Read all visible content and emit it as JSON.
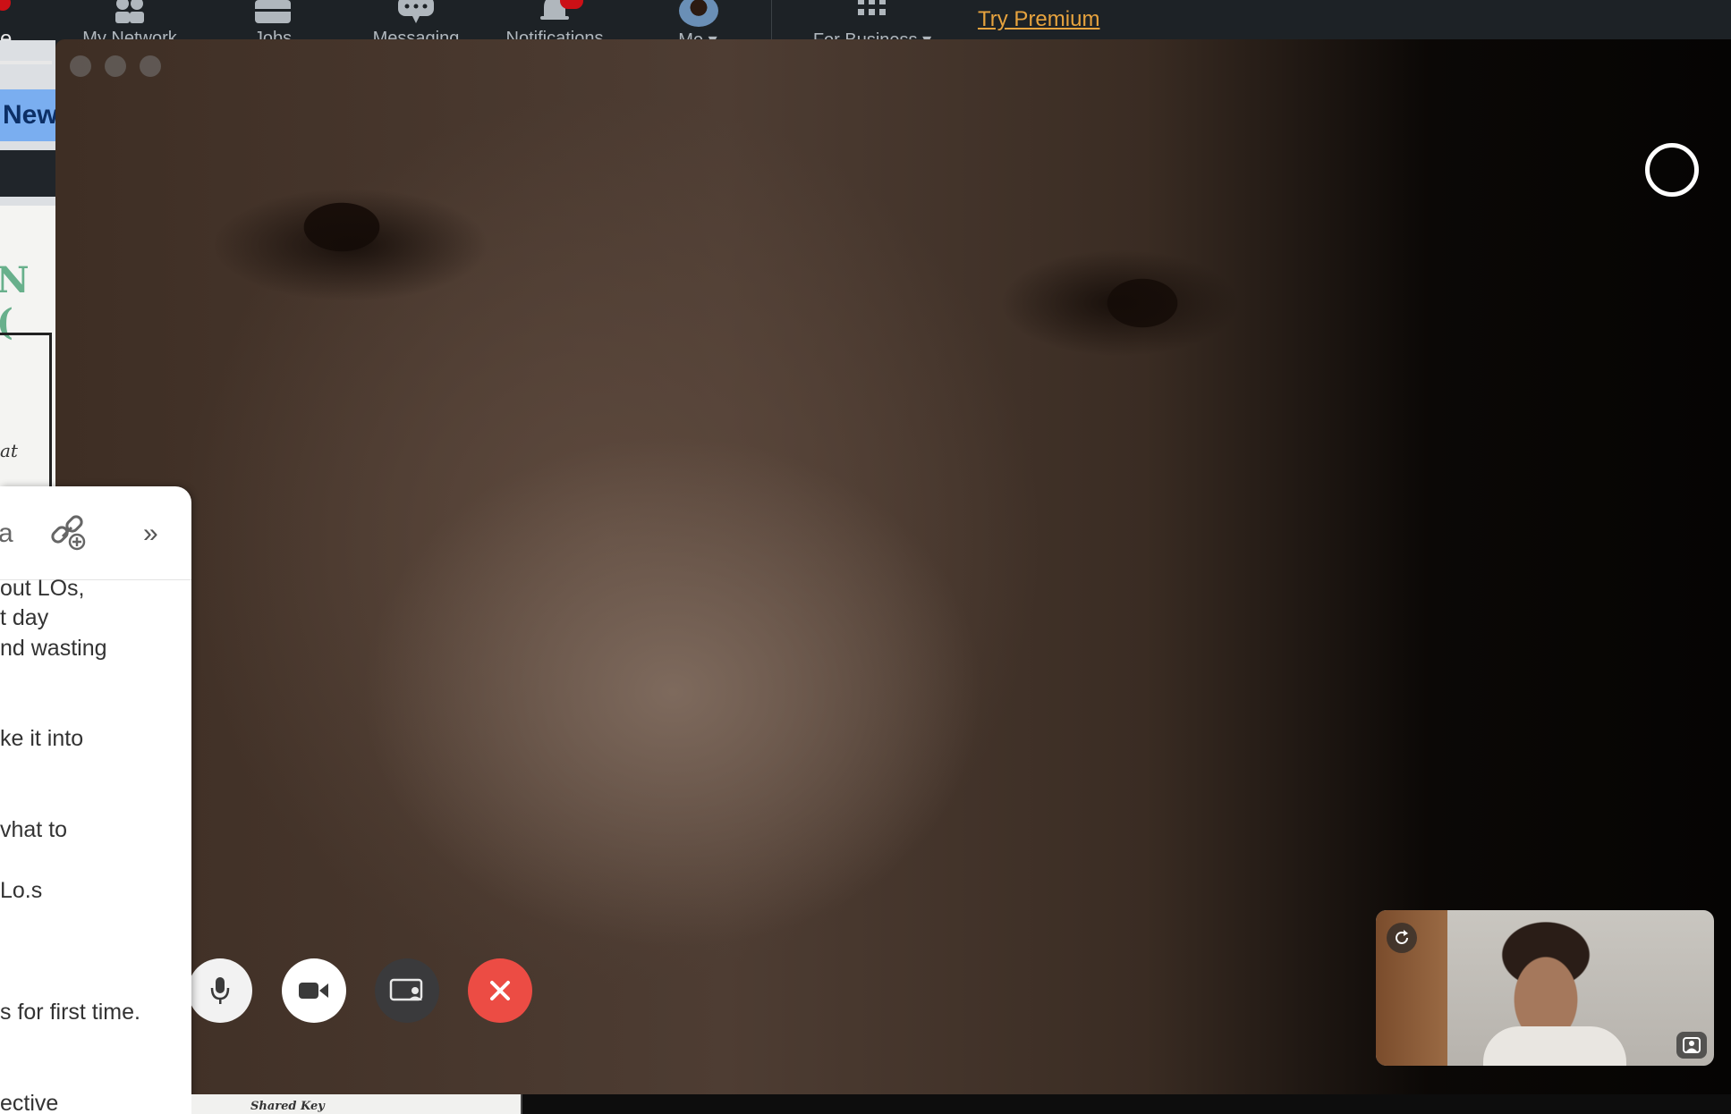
{
  "topnav": {
    "home_label_fragment": "e",
    "items": [
      {
        "label": "My Network",
        "icon": "people-icon"
      },
      {
        "label": "Jobs",
        "icon": "briefcase-icon"
      },
      {
        "label": "Messaging",
        "icon": "chat-icon"
      },
      {
        "label": "Notifications",
        "icon": "bell-icon"
      },
      {
        "label": "Me ▾",
        "icon": "avatar"
      },
      {
        "label": "For Business ▾",
        "icon": "grid-icon"
      }
    ],
    "premium_link": "Try Premium"
  },
  "background_doc": {
    "new_button": "New",
    "handwritten_fragment": "N (",
    "small_text_fragment": "at"
  },
  "notes": {
    "toolbar_text": "a",
    "lines": [
      "out LOs,",
      "t day",
      "nd wasting",
      "ke it into",
      "vhat to",
      "Lo.s",
      "s for first time.",
      "ective"
    ]
  },
  "bottom_doc_text": "Shared Key",
  "call": {
    "controls": [
      "mic-button",
      "camera-button",
      "screen-share-button",
      "end-call-button"
    ],
    "colors": {
      "end_call": "#ec4c44",
      "premium": "#e7a33e",
      "new_button": "#7aaef0"
    }
  }
}
